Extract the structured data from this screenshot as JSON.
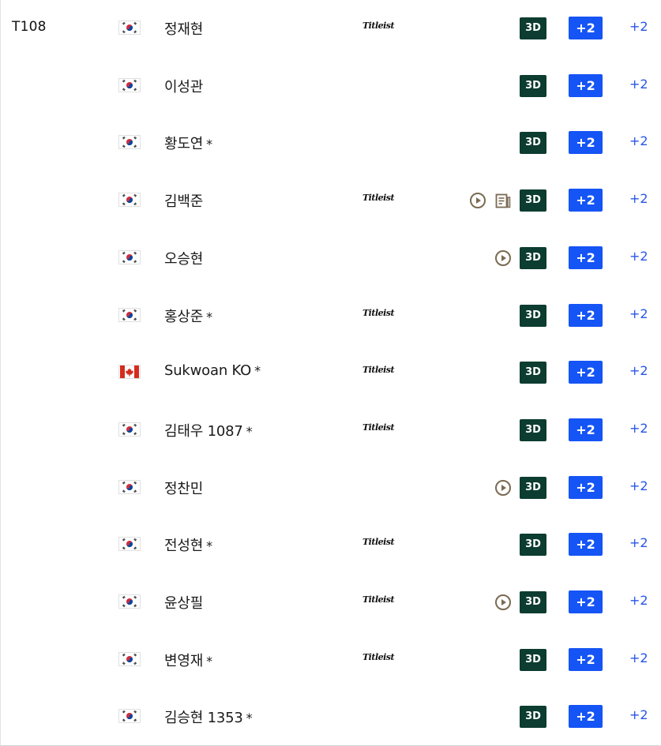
{
  "leaderboard": {
    "position_label": "T108",
    "colors": {
      "three_d_bg": "#0d3c30",
      "score_bg": "#1554f5",
      "today_text": "#2855e8",
      "icon_color": "#7a6a52"
    },
    "rows": [
      {
        "name": "정재현",
        "star": "",
        "flag": "south-korea-flag-icon",
        "sponsor": "Titleist",
        "video": false,
        "news": false,
        "three_d": "3D",
        "score": "+2",
        "today": "+2"
      },
      {
        "name": "이성관",
        "star": "",
        "flag": "south-korea-flag-icon",
        "sponsor": "",
        "video": false,
        "news": false,
        "three_d": "3D",
        "score": "+2",
        "today": "+2"
      },
      {
        "name": "황도연",
        "star": "*",
        "flag": "south-korea-flag-icon",
        "sponsor": "",
        "video": false,
        "news": false,
        "three_d": "3D",
        "score": "+2",
        "today": "+2"
      },
      {
        "name": "김백준",
        "star": "",
        "flag": "south-korea-flag-icon",
        "sponsor": "Titleist",
        "video": true,
        "news": true,
        "three_d": "3D",
        "score": "+2",
        "today": "+2"
      },
      {
        "name": "오승현",
        "star": "",
        "flag": "south-korea-flag-icon",
        "sponsor": "",
        "video": true,
        "news": false,
        "three_d": "3D",
        "score": "+2",
        "today": "+2"
      },
      {
        "name": "홍상준",
        "star": "*",
        "flag": "south-korea-flag-icon",
        "sponsor": "Titleist",
        "video": false,
        "news": false,
        "three_d": "3D",
        "score": "+2",
        "today": "+2"
      },
      {
        "name": "Sukwoan KO",
        "star": "*",
        "flag": "canada-flag-icon",
        "sponsor": "Titleist",
        "video": false,
        "news": false,
        "three_d": "3D",
        "score": "+2",
        "today": "+2"
      },
      {
        "name": "김태우 1087",
        "star": "*",
        "flag": "south-korea-flag-icon",
        "sponsor": "Titleist",
        "video": false,
        "news": false,
        "three_d": "3D",
        "score": "+2",
        "today": "+2"
      },
      {
        "name": "정찬민",
        "star": "",
        "flag": "south-korea-flag-icon",
        "sponsor": "",
        "video": true,
        "news": false,
        "three_d": "3D",
        "score": "+2",
        "today": "+2"
      },
      {
        "name": "전성현",
        "star": "*",
        "flag": "south-korea-flag-icon",
        "sponsor": "Titleist",
        "video": false,
        "news": false,
        "three_d": "3D",
        "score": "+2",
        "today": "+2"
      },
      {
        "name": "윤상필",
        "star": "",
        "flag": "south-korea-flag-icon",
        "sponsor": "Titleist",
        "video": true,
        "news": false,
        "three_d": "3D",
        "score": "+2",
        "today": "+2"
      },
      {
        "name": "변영재",
        "star": "*",
        "flag": "south-korea-flag-icon",
        "sponsor": "Titleist",
        "video": false,
        "news": false,
        "three_d": "3D",
        "score": "+2",
        "today": "+2"
      },
      {
        "name": "김승현 1353",
        "star": "*",
        "flag": "south-korea-flag-icon",
        "sponsor": "",
        "video": false,
        "news": false,
        "three_d": "3D",
        "score": "+2",
        "today": "+2"
      }
    ]
  }
}
